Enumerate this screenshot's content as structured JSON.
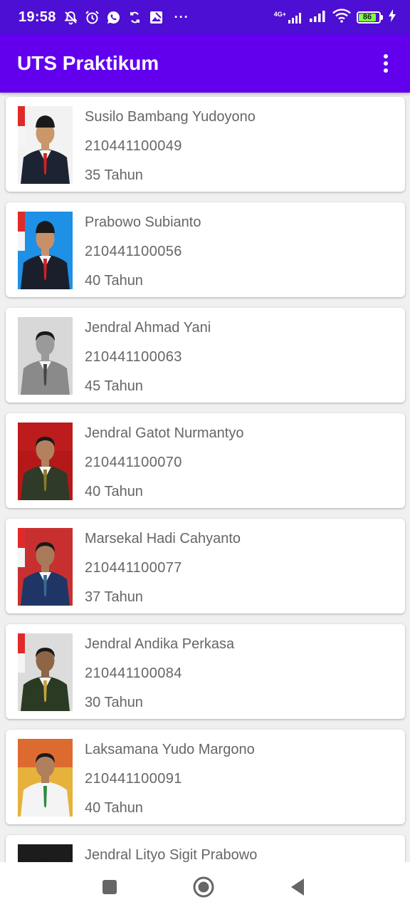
{
  "status_bar": {
    "time": "19:58",
    "network_label": "4G+",
    "battery_level": "86",
    "icons": [
      "mute-icon",
      "alarm-icon",
      "whatsapp-icon",
      "sync-icon",
      "image-icon",
      "more-dots-icon",
      "signal-4g-icon",
      "signal-icon",
      "wifi-icon",
      "battery-icon",
      "charging-icon"
    ],
    "more": "···"
  },
  "app_bar": {
    "title": "UTS Praktikum",
    "color": "#6200ee",
    "menu_icon": "more-vert-icon"
  },
  "people": [
    {
      "name": "Susilo Bambang Yudoyono",
      "nim": "210441100049",
      "age": "35 Tahun"
    },
    {
      "name": "Prabowo Subianto",
      "nim": "210441100056",
      "age": "40 Tahun"
    },
    {
      "name": "Jendral Ahmad Yani",
      "nim": "210441100063",
      "age": "45 Tahun"
    },
    {
      "name": "Jendral Gatot Nurmantyo",
      "nim": "210441100070",
      "age": "40 Tahun"
    },
    {
      "name": "Marsekal Hadi Cahyanto",
      "nim": "210441100077",
      "age": "37 Tahun"
    },
    {
      "name": "Jendral Andika Perkasa",
      "nim": "210441100084",
      "age": "30 Tahun"
    },
    {
      "name": "Laksamana Yudo Margono",
      "nim": "210441100091",
      "age": "40 Tahun"
    },
    {
      "name": "Jendral Lityo Sigit Prabowo",
      "nim": "",
      "age": ""
    }
  ],
  "nav_bar": {
    "icons": [
      "recents-square-icon",
      "home-circle-icon",
      "back-triangle-icon"
    ]
  }
}
